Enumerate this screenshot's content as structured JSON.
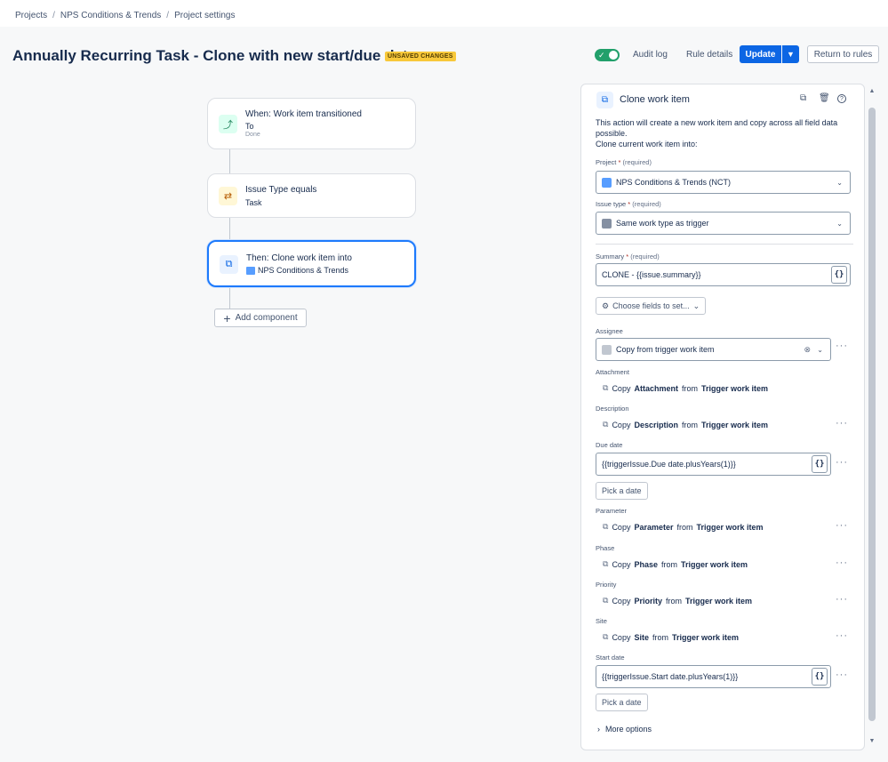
{
  "breadcrumbs": [
    "Projects",
    "NPS Conditions & Trends",
    "Project settings"
  ],
  "header": {
    "title": "Annually Recurring Task - Clone with new start/due dates",
    "badge": "UNSAVED CHANGES",
    "toggle_on": true,
    "audit_log": "Audit log",
    "rule_details": "Rule details",
    "update": "Update",
    "return": "Return to rules"
  },
  "flow": {
    "trigger": {
      "title": "When: Work item transitioned",
      "line2": "To",
      "line3": "Done",
      "icon": "transition-icon"
    },
    "condition": {
      "title": "Issue Type equals",
      "line2": "Task",
      "icon": "compare-icon"
    },
    "action": {
      "title": "Then: Clone work item into",
      "line2": "NPS Conditions & Trends",
      "icon": "clone-icon"
    },
    "add_component": "Add component"
  },
  "panel": {
    "title": "Clone work item",
    "description": "This action will create a new work item and copy across all field data possible.",
    "description2": "Clone current work item into:",
    "project": {
      "label": "Project",
      "req": "(required)",
      "value": "NPS Conditions & Trends (NCT)"
    },
    "issue_type": {
      "label": "Issue type",
      "req": "(required)",
      "value": "Same work type as trigger"
    },
    "summary": {
      "label": "Summary",
      "req": "(required)",
      "value": "CLONE - {{issue.summary}}"
    },
    "choose_fields": "Choose fields to set...",
    "assignee": {
      "label": "Assignee",
      "value": "Copy from trigger work item"
    },
    "attachment": {
      "label": "Attachment",
      "pre": "Copy",
      "field": "Attachment",
      "mid": "from",
      "src": "Trigger work item"
    },
    "description_field": {
      "label": "Description",
      "pre": "Copy",
      "field": "Description",
      "mid": "from",
      "src": "Trigger work item"
    },
    "due_date": {
      "label": "Due date",
      "value": "{{triggerIssue.Due date.plusYears(1)}}",
      "pick": "Pick a date"
    },
    "parameter": {
      "label": "Parameter",
      "pre": "Copy",
      "field": "Parameter",
      "mid": "from",
      "src": "Trigger work item"
    },
    "phase": {
      "label": "Phase",
      "pre": "Copy",
      "field": "Phase",
      "mid": "from",
      "src": "Trigger work item"
    },
    "priority": {
      "label": "Priority",
      "pre": "Copy",
      "field": "Priority",
      "mid": "from",
      "src": "Trigger work item"
    },
    "site": {
      "label": "Site",
      "pre": "Copy",
      "field": "Site",
      "mid": "from",
      "src": "Trigger work item"
    },
    "start_date": {
      "label": "Start date",
      "value": "{{triggerIssue.Start date.plusYears(1)}}",
      "pick": "Pick a date"
    },
    "more_options": "More options",
    "required_mark": "*"
  },
  "colors": {
    "accent": "#0c66e4",
    "toggle": "#22a06b",
    "badge": "#f8c83a"
  }
}
